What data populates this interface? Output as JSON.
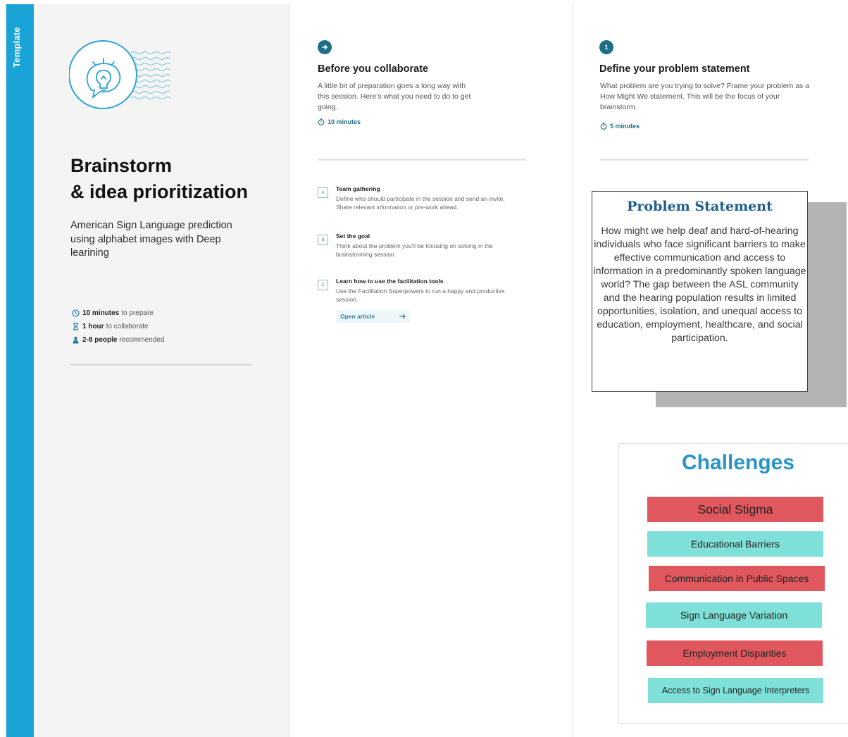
{
  "sidebar": {
    "label": "Template"
  },
  "intro": {
    "title_line1": "Brainstorm",
    "title_line2": "& idea prioritization",
    "description": "American Sign Language prediction using alphabet images with Deep learining",
    "meta": [
      {
        "icon": "clock-icon",
        "bold": "10 minutes",
        "text": "to prepare"
      },
      {
        "icon": "hourglass-icon",
        "bold": "1 hour",
        "text": "to collaborate"
      },
      {
        "icon": "person-icon",
        "bold": "2-8 people",
        "text": "recommended"
      }
    ]
  },
  "before": {
    "title": "Before you collaborate",
    "description": "A little bit of preparation goes a long way with this session. Here's what you need to do to get going.",
    "time": "10 minutes",
    "items": [
      {
        "letter": "A",
        "title": "Team gathering",
        "description": "Define who should participate in the session and send an invite. Share relevant information or pre-work ahead."
      },
      {
        "letter": "B",
        "title": "Set the goal",
        "description": "Think about the problem you'll be focusing on solving in the brainstorming session."
      },
      {
        "letter": "C",
        "title": "Learn how to use the facilitation tools",
        "description": "Use the Facilitation Superpowers to run a happy and productive session."
      }
    ],
    "open_article": "Open article"
  },
  "define": {
    "step": "1",
    "title": "Define your problem statement",
    "description": "What problem are you trying to solve? Frame your problem as a How Might We statement. This will be the focus of your brainstorm.",
    "time": "5 minutes"
  },
  "problem_statement": {
    "title": "Problem Statement",
    "text": "How might we help deaf and hard-of-hearing individuals who face significant barriers to make effective communication and access to information in a predominantly spoken language world? The gap between the ASL community and the hearing population results in limited opportunities, isolation, and unequal access to education, employment, healthcare, and social participation."
  },
  "challenges": {
    "title": "Challenges",
    "items": [
      {
        "label": "Social Stigma",
        "color": "#e0585d"
      },
      {
        "label": "Educational Barriers",
        "color": "#7ee0d8"
      },
      {
        "label": "Communication in Public Spaces",
        "color": "#e0585d"
      },
      {
        "label": "Sign Language Variation",
        "color": "#7ee0d8"
      },
      {
        "label": "Employment Disparities",
        "color": "#e0585d"
      },
      {
        "label": "Access to Sign Language Interpreters",
        "color": "#7ee0d8"
      }
    ]
  },
  "colors": {
    "accent": "#1aa3d7",
    "badge": "#1d6f89",
    "challenge_title": "#2b94c7"
  }
}
